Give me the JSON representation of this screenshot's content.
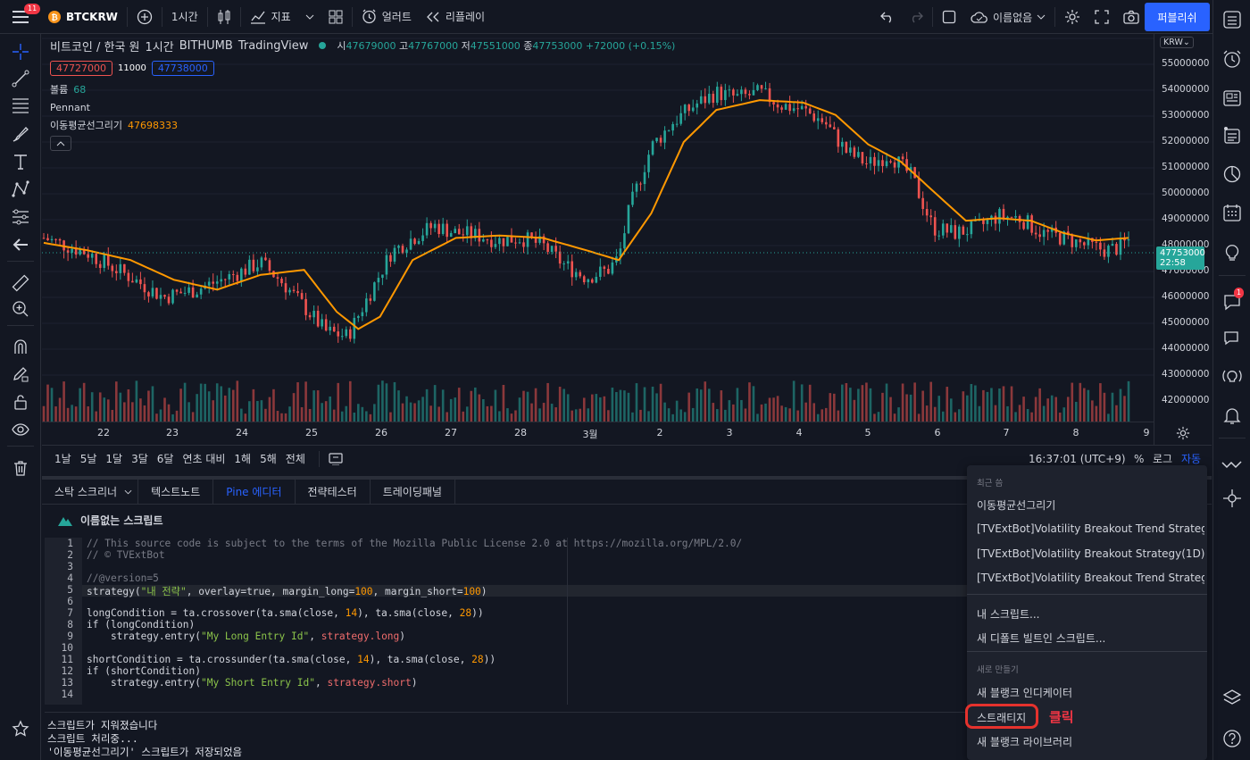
{
  "topbar": {
    "badge": "11",
    "symbol": "BTCKRW",
    "interval": "1시간",
    "indicators": "지표",
    "alert": "얼러트",
    "replay": "리플레이",
    "layout_name": "이름없음",
    "publish": "퍼블리쉬"
  },
  "legend": {
    "title": "비트코인 / 한국 원",
    "interval": "1시간",
    "exchange": "BITHUMB",
    "source": "TradingView",
    "open_label": "시",
    "open": "47679000",
    "high_label": "고",
    "high": "47767000",
    "low_label": "저",
    "low": "47551000",
    "close_label": "종",
    "close": "47753000",
    "change": "+72000 (+0.15%)",
    "sell_price": "47727000",
    "spread": "11000",
    "buy_price": "47738000",
    "volume_label": "볼륨",
    "volume_value": "68",
    "pattern": "Pennant",
    "ma_label": "이동평균선그리기",
    "ma_value": "47698333"
  },
  "yaxis": {
    "currency": "KRW",
    "ticks": [
      "55000000",
      "54000000",
      "53000000",
      "52000000",
      "51000000",
      "50000000",
      "49000000",
      "48000000",
      "47000000",
      "46000000",
      "45000000",
      "44000000",
      "43000000",
      "42000000"
    ],
    "last_price": "47753000",
    "countdown": "22:58"
  },
  "xaxis": {
    "ticks": [
      "22",
      "23",
      "24",
      "25",
      "26",
      "27",
      "28",
      "3월",
      "2",
      "3",
      "4",
      "5",
      "6",
      "7",
      "8",
      "9"
    ]
  },
  "colors": {
    "up": "#26a69a",
    "down": "#ef5350",
    "ma": "#ff9800",
    "accent": "#2962ff"
  },
  "rangebar": {
    "ranges": [
      "1날",
      "5날",
      "1달",
      "3달",
      "6달",
      "연초 대비",
      "1해",
      "5해",
      "전체"
    ],
    "time": "16:37:01 (UTC+9)",
    "percent": "%",
    "log": "로그",
    "auto": "자동"
  },
  "tabs": [
    "스탁 스크리너",
    "텍스트노트",
    "Pine 에디터",
    "전략테스터",
    "트레이딩패널"
  ],
  "script_title": "이름없는 스크립트",
  "editor": {
    "line_numbers": [
      "1",
      "2",
      "3",
      "4",
      "5",
      "6",
      "7",
      "8",
      "9",
      "10",
      "11",
      "12",
      "13",
      "14"
    ]
  },
  "console": {
    "lines": [
      "스크립트가 지워졌습니다",
      "스크립트 처리중...",
      "'이동평균선그리기' 스크립트가 저장되었음"
    ]
  },
  "dropdown": {
    "recent_header": "최근 씀",
    "recent": [
      "이동평균선그리기",
      "[TVExtBot]Volatility Breakout Trend Strategy(",
      "[TVExtBot]Volatility Breakout Strategy(1D)",
      "[TVExtBot]Volatility Breakout Trend Strategy("
    ],
    "my_scripts": "내 스크립트...",
    "new_default": "새 디폴트 빌트인 스크립트...",
    "new_header": "새로 만들기",
    "new_indicator": "새 블랭크 인디케이터",
    "strategy": "스트래티지",
    "new_library": "새 블랭크 라이브러리"
  },
  "annotation": {
    "click": "클릭"
  },
  "chart_data": {
    "type": "candlestick",
    "x_range": [
      "21",
      "9"
    ],
    "ylim": [
      41500000,
      55800000
    ],
    "close_path": [
      [
        0,
        47800000
      ],
      [
        4,
        47200000
      ],
      [
        8,
        46200000
      ],
      [
        11,
        45400000
      ],
      [
        14,
        45700000
      ],
      [
        17,
        46200000
      ],
      [
        20,
        46800000
      ],
      [
        22,
        46000000
      ],
      [
        24,
        45000000
      ],
      [
        26,
        44000000
      ],
      [
        28,
        43800000
      ],
      [
        30,
        45500000
      ],
      [
        32,
        47200000
      ],
      [
        34,
        47800000
      ],
      [
        36,
        48300000
      ],
      [
        38,
        48000000
      ],
      [
        40,
        47900000
      ],
      [
        42,
        47700000
      ],
      [
        44,
        47800000
      ],
      [
        46,
        47500000
      ],
      [
        48,
        46700000
      ],
      [
        50,
        46200000
      ],
      [
        52,
        46500000
      ],
      [
        53,
        47000000
      ],
      [
        54,
        49000000
      ],
      [
        56,
        51500000
      ],
      [
        58,
        52500000
      ],
      [
        60,
        53200000
      ],
      [
        62,
        53700000
      ],
      [
        64,
        53500000
      ],
      [
        66,
        53700000
      ],
      [
        68,
        53200000
      ],
      [
        70,
        53000000
      ],
      [
        72,
        52500000
      ],
      [
        74,
        51300000
      ],
      [
        76,
        50800000
      ],
      [
        78,
        51200000
      ],
      [
        80,
        50300000
      ],
      [
        82,
        48200000
      ],
      [
        84,
        48000000
      ],
      [
        86,
        48200000
      ],
      [
        88,
        48700000
      ],
      [
        90,
        48600000
      ],
      [
        92,
        48000000
      ],
      [
        94,
        47800000
      ],
      [
        96,
        47500000
      ],
      [
        98,
        47300000
      ],
      [
        99,
        47400000
      ],
      [
        100,
        47700000
      ]
    ],
    "ma_path": [
      [
        0,
        47600000
      ],
      [
        4,
        47300000
      ],
      [
        8,
        46900000
      ],
      [
        12,
        46100000
      ],
      [
        16,
        45700000
      ],
      [
        20,
        46300000
      ],
      [
        24,
        46500000
      ],
      [
        27,
        44800000
      ],
      [
        29,
        44100000
      ],
      [
        31,
        44600000
      ],
      [
        34,
        46900000
      ],
      [
        38,
        47800000
      ],
      [
        42,
        47900000
      ],
      [
        46,
        47800000
      ],
      [
        50,
        47300000
      ],
      [
        53,
        46900000
      ],
      [
        56,
        48800000
      ],
      [
        59,
        51700000
      ],
      [
        62,
        53000000
      ],
      [
        66,
        53400000
      ],
      [
        70,
        53300000
      ],
      [
        73,
        52800000
      ],
      [
        76,
        51600000
      ],
      [
        79,
        50900000
      ],
      [
        82,
        49700000
      ],
      [
        85,
        48500000
      ],
      [
        88,
        48600000
      ],
      [
        91,
        48500000
      ],
      [
        94,
        48000000
      ],
      [
        97,
        47700000
      ],
      [
        100,
        47800000
      ]
    ]
  }
}
